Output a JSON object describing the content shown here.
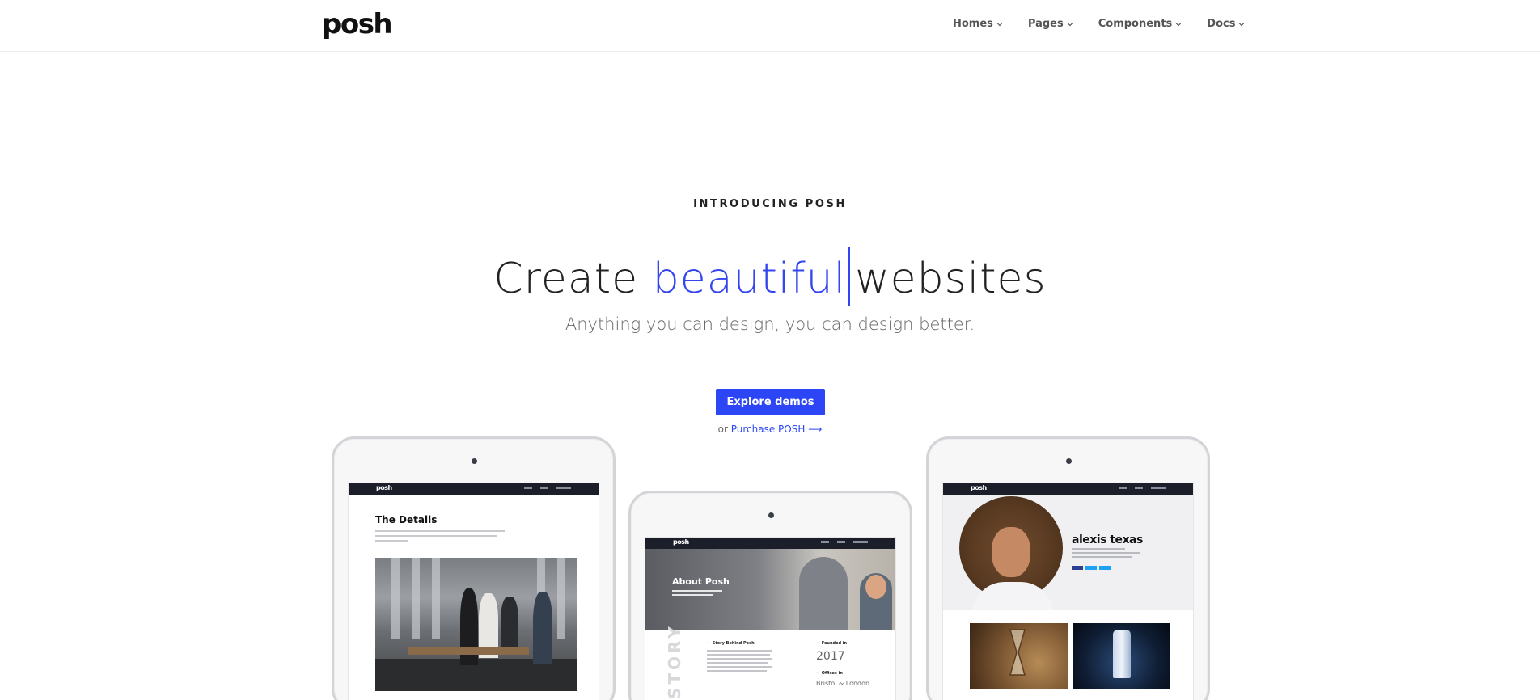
{
  "brand": {
    "logo": "posh"
  },
  "nav": {
    "items": [
      {
        "label": "Homes"
      },
      {
        "label": "Pages"
      },
      {
        "label": "Components"
      },
      {
        "label": "Docs"
      }
    ]
  },
  "hero": {
    "eyebrow": "INTRODUCING POSH",
    "headline_before": "Create",
    "headline_accent": "beautiful",
    "headline_after": "websites",
    "subhead": "Anything you can design, you can design better.",
    "cta_label": "Explore demos",
    "purchase_prefix": "or",
    "purchase_link": "Purchase POSH",
    "purchase_arrow": "⟶"
  },
  "tablets": {
    "t1": {
      "logo": "posh",
      "title": "The Details"
    },
    "t2": {
      "logo": "posh",
      "title": "About Posh",
      "side_word": "STORY",
      "col1_heading": "— Story Behind Posh",
      "col2_heading": "— Founded in",
      "year": "2017",
      "col3_heading": "— Offices in",
      "place": "Bristol & London"
    },
    "t3": {
      "logo": "posh",
      "name": "alexis texas"
    }
  },
  "colors": {
    "accent": "#2c46f5",
    "caret": "#3345ef",
    "mini_nav": "#1c1f2a"
  }
}
